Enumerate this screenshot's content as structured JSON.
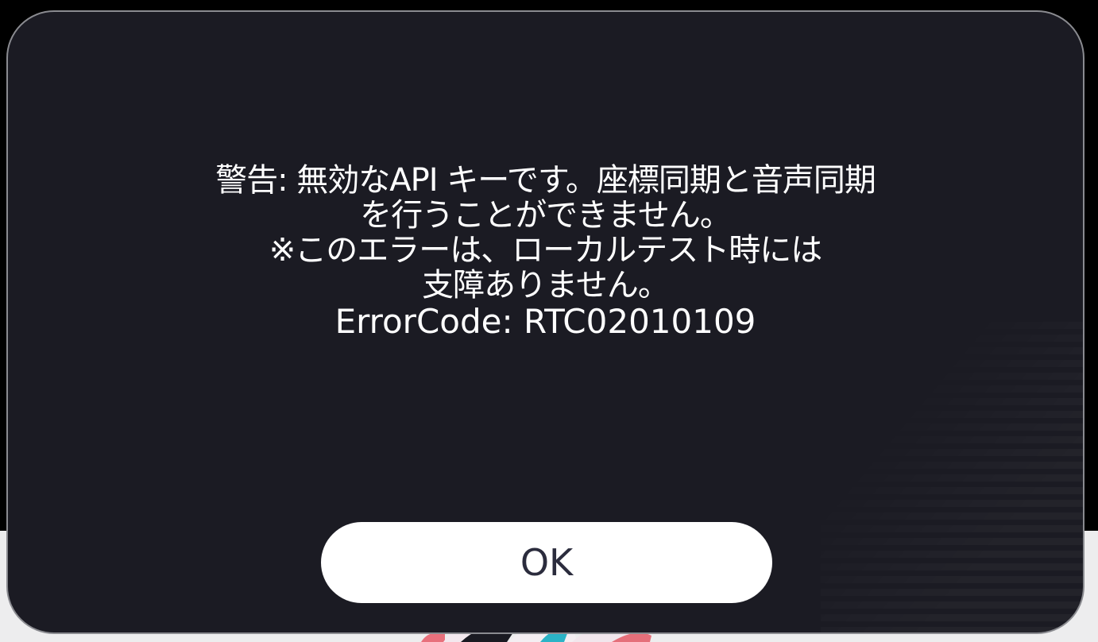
{
  "dialog": {
    "message_lines": [
      "警告: 無効なAPI キーです。座標同期と音声同期",
      "を行うことができません。",
      "※このエラーは、ローカルテスト時には",
      "支障ありません。"
    ],
    "error_code": "ErrorCode: RTC02010109",
    "ok_label": "OK"
  },
  "colors": {
    "dialog_background": "#1b1b23",
    "dialog_border": "#8a8b90",
    "text": "#ffffff",
    "button_background": "#ffffff",
    "button_text": "#2b2c3d",
    "backdrop": "#ededee"
  }
}
